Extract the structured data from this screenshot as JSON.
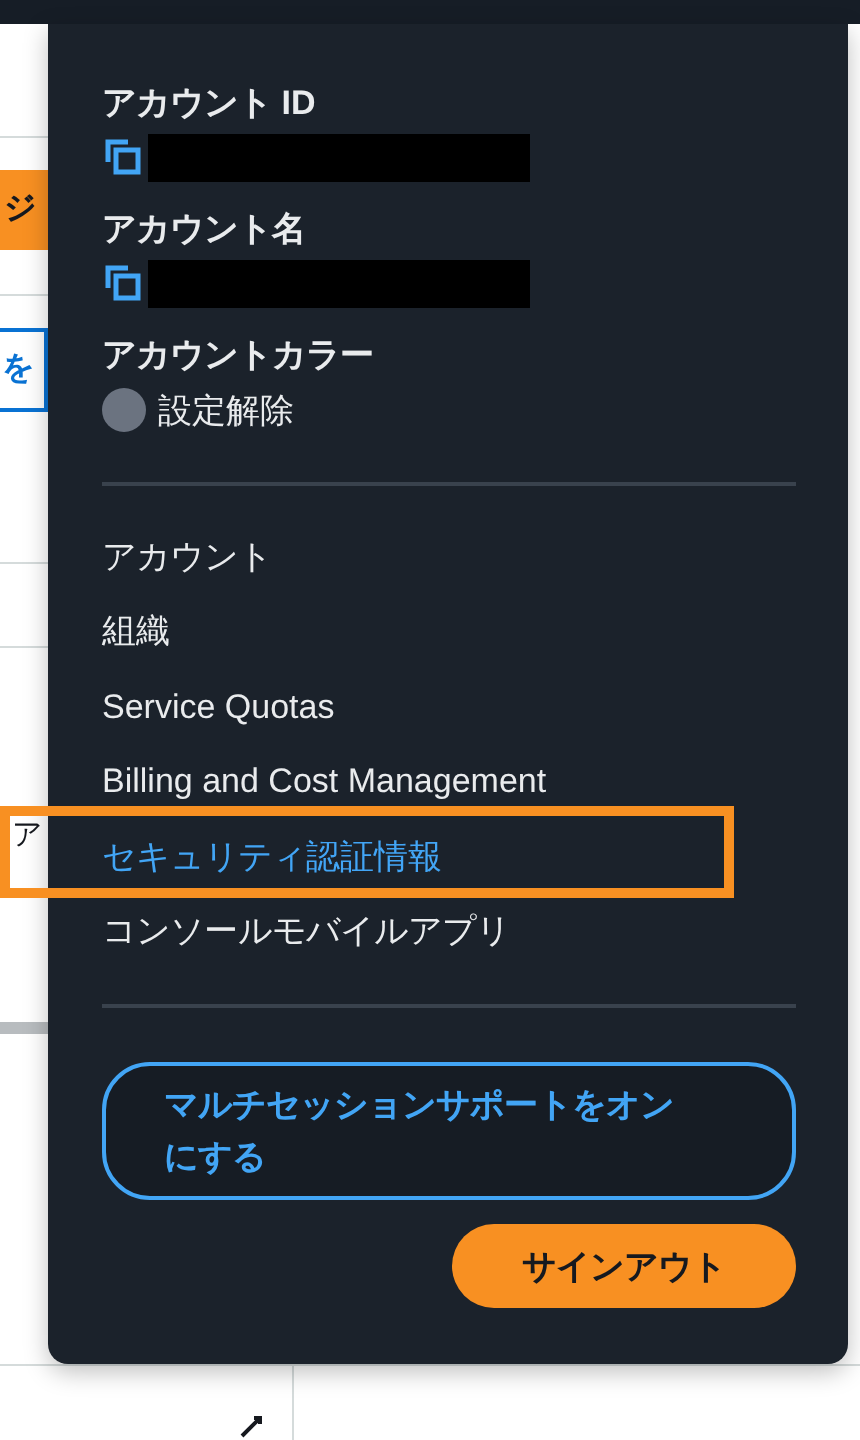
{
  "backdrop": {
    "fragments": [
      {
        "kind": "button",
        "text": "ジ"
      },
      {
        "kind": "link",
        "text": "を"
      },
      {
        "kind": "label",
        "text": "ア"
      }
    ]
  },
  "menu": {
    "account_fields": [
      {
        "kind": "copy",
        "label": "アカウント ID",
        "redacted": true
      },
      {
        "kind": "copy",
        "label": "アカウント名",
        "redacted": true
      },
      {
        "kind": "color",
        "label": "アカウントカラー",
        "value": "設定解除",
        "color": "#6b7380"
      }
    ],
    "items": [
      {
        "label": "アカウント",
        "selected": false,
        "annotated": false
      },
      {
        "label": "組織",
        "selected": false,
        "annotated": false
      },
      {
        "label": "Service Quotas",
        "selected": false,
        "annotated": false
      },
      {
        "label": "Billing and Cost Management",
        "selected": false,
        "annotated": false
      },
      {
        "label": "セキュリティ認証情報",
        "selected": true,
        "annotated": true
      },
      {
        "label": "コンソールモバイルアプリ",
        "selected": false,
        "annotated": false
      }
    ],
    "buttons": [
      {
        "kind": "secondary",
        "label": "マルチセッションサポートをオンにする"
      },
      {
        "kind": "primary",
        "label": "サインアウト"
      }
    ]
  }
}
